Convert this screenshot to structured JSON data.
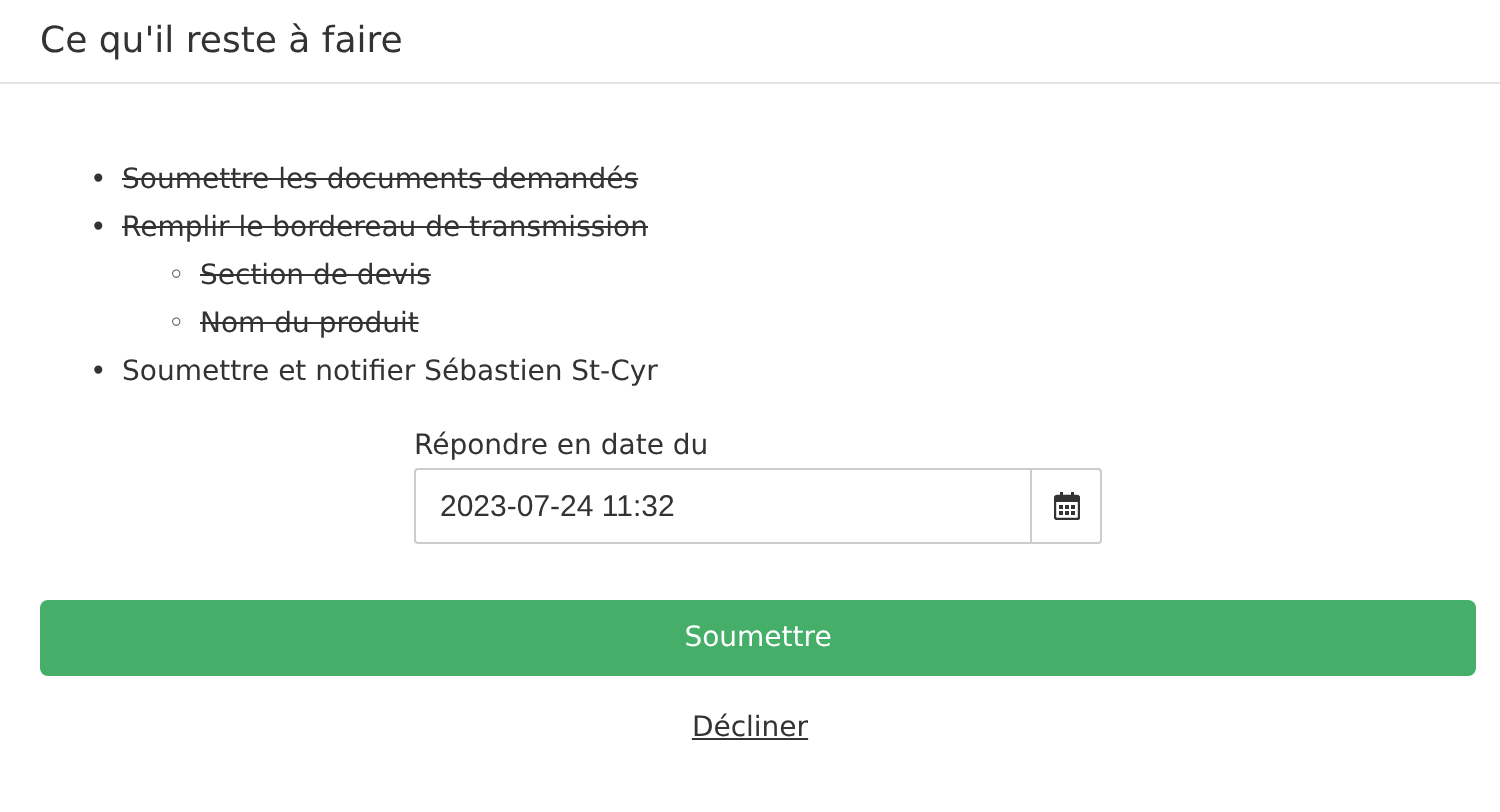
{
  "header": {
    "title": "Ce qu'il reste à faire"
  },
  "tasks": [
    {
      "marker": "•",
      "label": "Soumettre les documents demandés",
      "done": true
    },
    {
      "marker": "•",
      "label": "Remplir le bordereau de transmission",
      "done": true,
      "children": [
        {
          "marker": "◦",
          "label": "Section de devis",
          "done": true
        },
        {
          "marker": "◦",
          "label": "Nom du produit",
          "done": true
        }
      ]
    },
    {
      "marker": "•",
      "label": "Soumettre et notifier Sébastien St-Cyr",
      "done": false
    }
  ],
  "date_field": {
    "label": "Répondre en date du",
    "value": "2023-07-24 11:32"
  },
  "submit_button": "Soumettre",
  "decline_link": "Décliner"
}
